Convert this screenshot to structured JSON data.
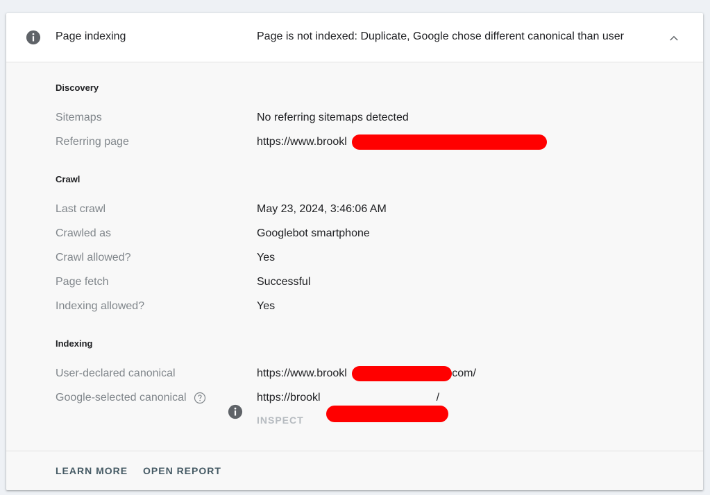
{
  "header": {
    "title": "Page indexing",
    "status": "Page is not indexed: Duplicate, Google chose different canonical than user",
    "info_icon": "info-icon",
    "collapse_icon": "chevron-up-icon"
  },
  "discovery": {
    "title": "Discovery",
    "rows": [
      {
        "label": "Sitemaps",
        "value": "No referring sitemaps detected"
      },
      {
        "label": "Referring page",
        "value": "https://www.brookl"
      }
    ]
  },
  "crawl": {
    "title": "Crawl",
    "rows": [
      {
        "label": "Last crawl",
        "value": "May 23, 2024, 3:46:06 AM"
      },
      {
        "label": "Crawled as",
        "value": "Googlebot smartphone"
      },
      {
        "label": "Crawl allowed?",
        "value": "Yes"
      },
      {
        "label": "Page fetch",
        "value": "Successful"
      },
      {
        "label": "Indexing allowed?",
        "value": "Yes"
      }
    ]
  },
  "indexing": {
    "title": "Indexing",
    "rows": [
      {
        "label": "User-declared canonical",
        "value_prefix": "https://www.brookl",
        "value_suffix": ".com/"
      },
      {
        "label": "Google-selected canonical",
        "value_prefix": "https://brookl",
        "value_suffix": "/",
        "help_icon": "help-circle-icon",
        "info_icon": "info-icon"
      }
    ],
    "inspect_label": "INSPECT"
  },
  "footer": {
    "learn_more": "LEARN MORE",
    "open_report": "OPEN REPORT"
  },
  "colors": {
    "redaction": "#ff0000",
    "label_gray": "#80868b",
    "icon_gray": "#5f6368"
  }
}
